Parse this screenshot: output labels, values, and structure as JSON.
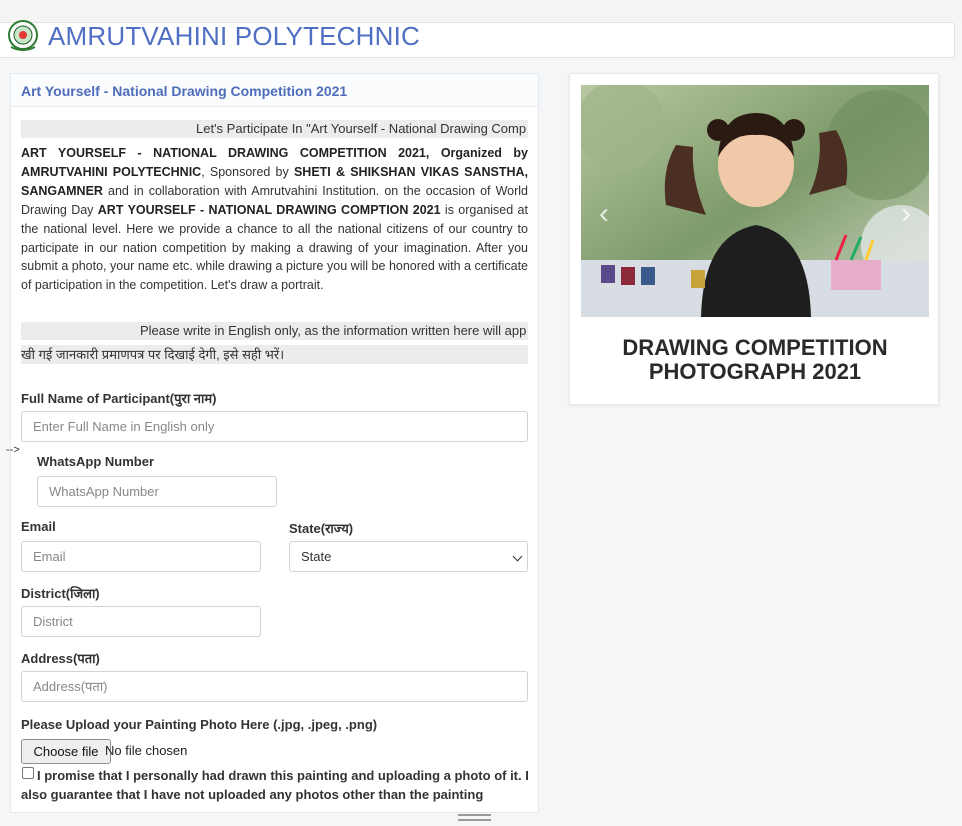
{
  "header": {
    "brand": "AMRUTVAHINI POLYTECHNIC",
    "logo_icon": "college-emblem-icon"
  },
  "form": {
    "title": "Art Yourself - National Drawing Competition 2021",
    "marquee1": "Let's Participate In \"Art Yourself - National Drawing Comp",
    "intro": {
      "b1": "ART YOURSELF - NATIONAL DRAWING COMPETITION 2021, Organized by AMRUTVAHINI POLYTECHNIC",
      "t1": ", Sponsored by ",
      "b2": "SHETI & SHIKSHAN VIKAS SANSTHA, SANGAMNER",
      "t2": " and in collaboration with Amrutvahini Institution. on the occasion of World Drawing Day ",
      "b3": "ART YOURSELF - NATIONAL DRAWING COMPTION 2021",
      "t3": " is organised at the national level. Here we provide a chance to all the national citizens of our country to participate in our nation competition by making a drawing of your imagination. After you submit a photo, your name etc. while drawing a picture you will be honored with a certificate of participation in the competition. Let's draw a portrait."
    },
    "marquee2": "Please write in English only, as the information written here will app",
    "hindi_note": "खी गई जानकारी प्रमाणपत्र पर दिखाई देगी, इसे सही भरें।",
    "stray_text": "-->",
    "fields": {
      "full_name": {
        "label": "Full Name of Participant(पुरा नाम)",
        "placeholder": "Enter Full Name in English only"
      },
      "whatsapp": {
        "label": "WhatsApp Number",
        "placeholder": "WhatsApp Number"
      },
      "email": {
        "label": "Email",
        "placeholder": "Email"
      },
      "state": {
        "label": "State(राज्य)",
        "selected": "State"
      },
      "district": {
        "label": "District(जिला)",
        "placeholder": "District"
      },
      "address": {
        "label": "Address(पता)",
        "placeholder": "Address(पता)"
      }
    },
    "upload": {
      "label": "Please Upload your Painting Photo Here (.jpg, .jpeg, .png)",
      "button": "Choose file",
      "status": "No file chosen"
    },
    "promise_text": "I promise that I personally had drawn this painting and uploading a photo of it. I also guarantee that I have not uploaded any photos other than the painting"
  },
  "carousel": {
    "caption": "DRAWING COMPETITION PHOTOGRAPH 2021",
    "prev_icon": "chevron-left-icon",
    "next_icon": "chevron-right-icon"
  }
}
